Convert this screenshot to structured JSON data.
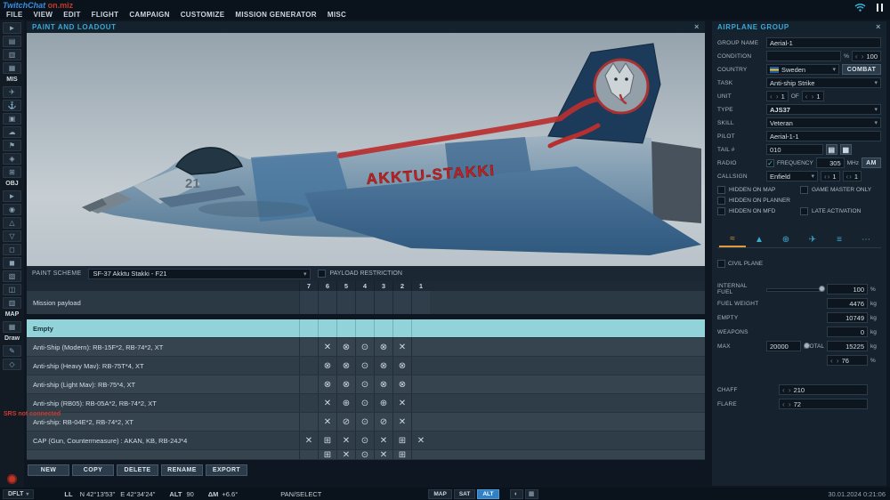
{
  "window": {
    "title_blue": "TwitchChat",
    "title_red": " on.miz"
  },
  "menu": {
    "items": [
      "FILE",
      "VIEW",
      "EDIT",
      "FLIGHT",
      "CAMPAIGN",
      "CUSTOMIZE",
      "MISSION GENERATOR",
      "MISC"
    ]
  },
  "sidebar": {
    "items": [
      {
        "text": "►",
        "name": "pointer-icon",
        "inter": "true"
      },
      {
        "text": "▤",
        "name": "new-mission-icon",
        "inter": "true"
      },
      {
        "text": "▥",
        "name": "open-mission-icon",
        "inter": "true"
      },
      {
        "text": "▦",
        "name": "save-mission-icon",
        "inter": "true"
      },
      {
        "text": "MIS",
        "name": "section-label-mis",
        "inter": "false",
        "label": true
      },
      {
        "text": "✈",
        "name": "aircraft-icon",
        "inter": "true"
      },
      {
        "text": "⚓",
        "name": "ship-icon",
        "inter": "true"
      },
      {
        "text": "▣",
        "name": "vehicle-icon",
        "inter": "true"
      },
      {
        "text": "☁",
        "name": "weather-icon",
        "inter": "true"
      },
      {
        "text": "⚑",
        "name": "flag-icon",
        "inter": "true"
      },
      {
        "text": "◈",
        "name": "trigger-zone-icon",
        "inter": "true"
      },
      {
        "text": "⊞",
        "name": "grid-icon",
        "inter": "true"
      },
      {
        "text": "OBJ",
        "name": "section-label-obj",
        "inter": "false",
        "label": true
      },
      {
        "text": "►",
        "name": "unit-list-icon",
        "inter": "true"
      },
      {
        "text": "◉",
        "name": "target-icon",
        "inter": "true"
      },
      {
        "text": "△",
        "name": "static-object-icon",
        "inter": "true"
      },
      {
        "text": "▽",
        "name": "template-icon",
        "inter": "true"
      },
      {
        "text": "◻",
        "name": "building-icon",
        "inter": "true"
      },
      {
        "text": "◼",
        "name": "farp-icon",
        "inter": "true"
      },
      {
        "text": "▧",
        "name": "group-icon",
        "inter": "true"
      },
      {
        "text": "◫",
        "name": "layers-icon",
        "inter": "true"
      },
      {
        "text": "▥",
        "name": "roads-icon",
        "inter": "true"
      },
      {
        "text": "MAP",
        "name": "section-label-map",
        "inter": "false",
        "label": true
      },
      {
        "text": "▦",
        "name": "map-options-icon",
        "inter": "true"
      },
      {
        "text": "Draw",
        "name": "section-label-draw",
        "inter": "false",
        "label": true
      },
      {
        "text": "✎",
        "name": "draw-tool-icon",
        "inter": "true"
      },
      {
        "text": "◇",
        "name": "shape-tool-icon",
        "inter": "true"
      }
    ]
  },
  "paint": {
    "title": "PAINT AND LOADOUT",
    "close": "×",
    "scheme_label": "PAINT SCHEME",
    "scheme": "SF-37 Akktu Stakki - F21",
    "payload_restriction": "PAYLOAD RESTRICTION"
  },
  "viewport": {
    "fuselage_text": "AKKTU-STAKKI",
    "nose_number": "21"
  },
  "loadout": {
    "columns": [
      "7",
      "6",
      "5",
      "4",
      "3",
      "2",
      "1"
    ],
    "mission_payload_label": "Mission payload",
    "rows": [
      {
        "label": "Empty",
        "selected": true,
        "cells": [
          "",
          "",
          "",
          "",
          "",
          "",
          ""
        ]
      },
      {
        "label": "Anti-Ship (Modern): RB-15F*2, RB-74*2, XT",
        "cells": [
          "",
          "✕",
          "⊗",
          "⊙",
          "⊗",
          "✕",
          ""
        ]
      },
      {
        "label": "Anti-ship (Heavy Mav): RB-75T*4, XT",
        "alt": true,
        "cells": [
          "",
          "⊗",
          "⊗",
          "⊙",
          "⊗",
          "⊗",
          ""
        ]
      },
      {
        "label": "Anti-ship (Light Mav): RB-75*4, XT",
        "cells": [
          "",
          "⊗",
          "⊗",
          "⊙",
          "⊗",
          "⊗",
          ""
        ]
      },
      {
        "label": "Anti-ship (RB05): RB-05A*2, RB-74*2, XT",
        "alt": true,
        "cells": [
          "",
          "✕",
          "⊕",
          "⊙",
          "⊕",
          "✕",
          ""
        ]
      },
      {
        "label": "Anti-ship: RB-04E*2, RB-74*2, XT",
        "cells": [
          "",
          "✕",
          "⊘",
          "⊙",
          "⊘",
          "✕",
          ""
        ]
      },
      {
        "label": "CAP (Gun, Countermeasure) : AKAN, KB, RB-24J*4",
        "alt": true,
        "cells": [
          "✕",
          "⊞",
          "✕",
          "⊙",
          "✕",
          "⊞",
          "✕"
        ]
      },
      {
        "label": "",
        "partial": true,
        "cells": [
          "",
          "⊞",
          "✕",
          "⊙",
          "✕",
          "⊞",
          ""
        ]
      }
    ],
    "buttons": [
      {
        "label": "NEW",
        "name": "new-button"
      },
      {
        "label": "COPY",
        "name": "copy-button"
      },
      {
        "label": "DELETE",
        "name": "delete-button"
      },
      {
        "label": "RENAME",
        "name": "rename-button"
      },
      {
        "label": "EXPORT",
        "name": "export-button"
      }
    ]
  },
  "group": {
    "title": "AIRPLANE GROUP",
    "close": "×",
    "name_label": "GROUP NAME",
    "name": "Aerial-1",
    "condition_label": "CONDITION",
    "condition_unit": "%",
    "condition_value": "100",
    "country_label": "COUNTRY",
    "country": "Sweden",
    "combat": "COMBAT",
    "task_label": "TASK",
    "task": "Anti-ship Strike",
    "unit_label": "UNIT",
    "unit_count": "1",
    "of": "OF",
    "unit_total": "1",
    "type_label": "TYPE",
    "type": "AJS37",
    "skill_label": "SKILL",
    "skill": "Veteran",
    "pilot_label": "PILOT",
    "pilot": "Aerial-1-1",
    "tail_label": "TAIL #",
    "tail": "010",
    "radio_label": "RADIO",
    "frequency_label": "FREQUENCY",
    "frequency": "305",
    "mhz": "MHz",
    "am": "AM",
    "callsign_label": "CALLSIGN",
    "callsign": "Enfield",
    "callsign_n1": "1",
    "callsign_n2": "1",
    "chk_hidden_map": "HIDDEN ON MAP",
    "chk_gm_only": "GAME MASTER ONLY",
    "chk_hidden_planner": "HIDDEN ON PLANNER",
    "chk_hidden_mfd": "HIDDEN ON MFD",
    "chk_late": "LATE ACTIVATION",
    "civil": "CIVIL PLANE",
    "fuel": {
      "internal_label": "INTERNAL FUEL",
      "internal": "100",
      "pct": "%",
      "weight_label": "FUEL WEIGHT",
      "weight": "4476",
      "kg": "kg",
      "empty_label": "EMPTY",
      "empty": "10749",
      "weapons_label": "WEAPONS",
      "weapons": "0",
      "max_label": "MAX",
      "max": "20000",
      "total_label": "TOTAL",
      "total": "15225",
      "ammo": "76"
    },
    "chaff_label": "CHAFF",
    "chaff": "210",
    "flare_label": "FLARE",
    "flare": "72"
  },
  "tabs": [
    {
      "glyph": "≈",
      "name": "tab-route",
      "active": true
    },
    {
      "glyph": "▲",
      "name": "tab-hazard"
    },
    {
      "glyph": "⊕",
      "name": "tab-targeting"
    },
    {
      "glyph": "✈",
      "name": "tab-aircraft"
    },
    {
      "glyph": "≡",
      "name": "tab-summary"
    },
    {
      "glyph": "⋯",
      "name": "tab-more"
    }
  ],
  "statusbar": {
    "dflt": "DFLT",
    "coords_ll": "LL",
    "lat": "N 42°13'53\"",
    "lon": "E 42°34'24\"",
    "alt_label": "ALT",
    "alt": "90",
    "mag_label": "ΔM",
    "mag": "+6.6°",
    "mode": "PAN/SELECT",
    "map": "MAP",
    "sat": "SAT",
    "alt_btn": "ALT",
    "clock": "30.01.2024 0:21:06"
  },
  "srs": "SRS not connected"
}
